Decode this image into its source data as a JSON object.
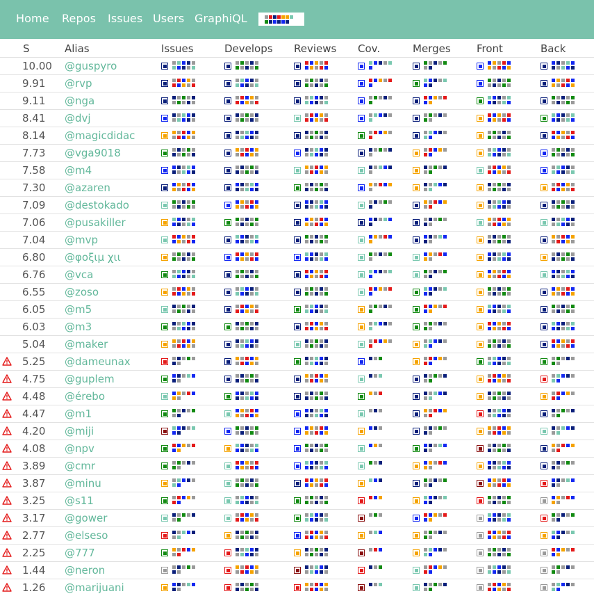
{
  "nav": {
    "links": [
      "Home",
      "Repos",
      "Issues",
      "Users",
      "GraphiQL"
    ]
  },
  "colors": {
    "navy": "#0a1f7a",
    "blue": "#1328f2",
    "green": "#128a12",
    "orange": "#f5a300",
    "teal": "#7ac8b0",
    "gray": "#9a9a9a",
    "red": "#e41a1a",
    "maroon": "#8a1212",
    "accent": "#7ac2ac",
    "link": "#63b89b",
    "warning": "#e41a1a"
  },
  "table": {
    "headers": [
      "S",
      "Alias",
      "Issues",
      "Develops",
      "Reviews",
      "Cov.",
      "Merges",
      "Front",
      "Back"
    ],
    "rows": [
      {
        "score": "10.00",
        "alias": "@guspyro",
        "warn": false,
        "lvl": [
          "navy",
          "navy",
          "navy",
          "blue",
          "navy",
          "blue",
          "navy"
        ]
      },
      {
        "score": "9.91",
        "alias": "@rvp",
        "warn": false,
        "lvl": [
          "navy",
          "navy",
          "navy",
          "blue",
          "green",
          "blue",
          "navy"
        ]
      },
      {
        "score": "9.11",
        "alias": "@nga",
        "warn": false,
        "lvl": [
          "navy",
          "navy",
          "navy",
          "blue",
          "navy",
          "green",
          "navy"
        ]
      },
      {
        "score": "8.41",
        "alias": "@dvj",
        "warn": false,
        "lvl": [
          "blue",
          "navy",
          "teal",
          "blue",
          "navy",
          "orange",
          "green"
        ]
      },
      {
        "score": "8.14",
        "alias": "@magicdidac",
        "warn": false,
        "lvl": [
          "orange",
          "navy",
          "navy",
          "green",
          "navy",
          "orange",
          "navy"
        ]
      },
      {
        "score": "7.73",
        "alias": "@vga9018",
        "warn": false,
        "lvl": [
          "green",
          "navy",
          "blue",
          "navy",
          "orange",
          "orange",
          "blue"
        ]
      },
      {
        "score": "7.58",
        "alias": "@m4",
        "warn": false,
        "lvl": [
          "blue",
          "navy",
          "teal",
          "teal",
          "orange",
          "teal",
          "blue"
        ]
      },
      {
        "score": "7.30",
        "alias": "@azaren",
        "warn": false,
        "lvl": [
          "navy",
          "navy",
          "green",
          "blue",
          "orange",
          "orange",
          "orange"
        ]
      },
      {
        "score": "7.09",
        "alias": "@destokado",
        "warn": false,
        "lvl": [
          "teal",
          "blue",
          "navy",
          "teal",
          "navy",
          "orange",
          "navy"
        ]
      },
      {
        "score": "7.06",
        "alias": "@pusakiller",
        "warn": false,
        "lvl": [
          "orange",
          "green",
          "navy",
          "navy",
          "navy",
          "teal",
          "teal"
        ]
      },
      {
        "score": "7.04",
        "alias": "@mvp",
        "warn": false,
        "lvl": [
          "teal",
          "navy",
          "navy",
          "teal",
          "navy",
          "orange",
          "navy"
        ]
      },
      {
        "score": "6.80",
        "alias": "@φοξιμ χιι",
        "warn": false,
        "lvl": [
          "orange",
          "blue",
          "blue",
          "teal",
          "teal",
          "orange",
          "orange"
        ]
      },
      {
        "score": "6.76",
        "alias": "@vca",
        "warn": false,
        "lvl": [
          "green",
          "navy",
          "navy",
          "teal",
          "teal",
          "orange",
          "teal"
        ]
      },
      {
        "score": "6.55",
        "alias": "@zoso",
        "warn": false,
        "lvl": [
          "orange",
          "navy",
          "navy",
          "teal",
          "green",
          "orange",
          "navy"
        ]
      },
      {
        "score": "6.05",
        "alias": "@m5",
        "warn": false,
        "lvl": [
          "teal",
          "navy",
          "green",
          "orange",
          "green",
          "orange",
          "navy"
        ]
      },
      {
        "score": "6.03",
        "alias": "@m3",
        "warn": false,
        "lvl": [
          "green",
          "green",
          "navy",
          "orange",
          "green",
          "orange",
          "navy"
        ]
      },
      {
        "score": "5.04",
        "alias": "@maker",
        "warn": false,
        "lvl": [
          "orange",
          "navy",
          "teal",
          "teal",
          "orange",
          "orange",
          "navy"
        ]
      },
      {
        "score": "5.25",
        "alias": "@dameunax",
        "warn": true,
        "lvl": [
          "red",
          "navy",
          "green",
          "blue",
          "orange",
          "green",
          "green"
        ]
      },
      {
        "score": "4.75",
        "alias": "@guplem",
        "warn": true,
        "lvl": [
          "green",
          "navy",
          "navy",
          "teal",
          "navy",
          "orange",
          "red"
        ]
      },
      {
        "score": "4.48",
        "alias": "@érebo",
        "warn": true,
        "lvl": [
          "teal",
          "green",
          "navy",
          "green",
          "navy",
          "orange",
          "orange"
        ]
      },
      {
        "score": "4.47",
        "alias": "@m1",
        "warn": true,
        "lvl": [
          "green",
          "teal",
          "blue",
          "teal",
          "navy",
          "red",
          "navy"
        ]
      },
      {
        "score": "4.20",
        "alias": "@miji",
        "warn": true,
        "lvl": [
          "maroon",
          "blue",
          "blue",
          "orange",
          "navy",
          "orange",
          "teal"
        ]
      },
      {
        "score": "4.08",
        "alias": "@npv",
        "warn": true,
        "lvl": [
          "green",
          "orange",
          "blue",
          "teal",
          "green",
          "maroon",
          "navy"
        ]
      },
      {
        "score": "3.89",
        "alias": "@cmr",
        "warn": true,
        "lvl": [
          "green",
          "teal",
          "blue",
          "teal",
          "orange",
          "orange",
          "navy"
        ]
      },
      {
        "score": "3.87",
        "alias": "@minu",
        "warn": true,
        "lvl": [
          "orange",
          "teal",
          "navy",
          "orange",
          "navy",
          "maroon",
          "red"
        ]
      },
      {
        "score": "3.25",
        "alias": "@s11",
        "warn": true,
        "lvl": [
          "green",
          "teal",
          "green",
          "red",
          "orange",
          "red",
          "gray"
        ]
      },
      {
        "score": "3.17",
        "alias": "@gower",
        "warn": true,
        "lvl": [
          "teal",
          "teal",
          "green",
          "maroon",
          "blue",
          "gray",
          "red"
        ]
      },
      {
        "score": "2.77",
        "alias": "@elseso",
        "warn": true,
        "lvl": [
          "red",
          "orange",
          "blue",
          "orange",
          "orange",
          "gray",
          "orange"
        ]
      },
      {
        "score": "2.25",
        "alias": "@777",
        "warn": true,
        "lvl": [
          "green",
          "red",
          "orange",
          "maroon",
          "orange",
          "gray",
          "gray"
        ]
      },
      {
        "score": "1.44",
        "alias": "@neron",
        "warn": true,
        "lvl": [
          "gray",
          "red",
          "maroon",
          "red",
          "teal",
          "gray",
          "gray"
        ]
      },
      {
        "score": "1.26",
        "alias": "@marijuani",
        "warn": true,
        "lvl": [
          "orange",
          "red",
          "red",
          "maroon",
          "teal",
          "gray",
          "gray"
        ]
      }
    ]
  }
}
